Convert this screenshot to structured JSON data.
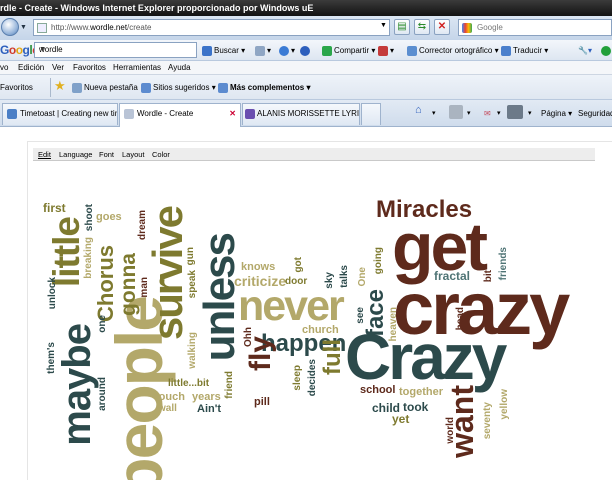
{
  "window": {
    "title": "rdle - Create - Windows Internet Explorer proporcionado por Windows uE"
  },
  "address": {
    "prefix": "http://www.",
    "domain": "wordle.net",
    "path": "/create",
    "search_placeholder": "Google"
  },
  "google_toolbar": {
    "logo": "Google",
    "query": "wordle",
    "buscar": "Buscar",
    "compartir": "Compartir",
    "corrector": "Corrector ortográfico",
    "traducir": "Traducir"
  },
  "menu": [
    "vo",
    "Edición",
    "Ver",
    "Favoritos",
    "Herramientas",
    "Ayuda"
  ],
  "favorites": {
    "label": "Favoritos",
    "items": [
      "Nueva pestaña",
      "Sitios sugeridos",
      "Más complementos"
    ]
  },
  "tabs": [
    {
      "label": "Timetoast | Creating new tim..."
    },
    {
      "label": "Wordle - Create"
    },
    {
      "label": "ALANIS MORISSETTE LYRICS..."
    }
  ],
  "command_bar": {
    "pagina": "Página",
    "seguridad": "Seguridad"
  },
  "wordle_menu": [
    "Edit",
    "Language",
    "Font",
    "Layout",
    "Color"
  ],
  "colors": {
    "dark_teal": "#2c4a4b",
    "brown": "#5e2a1c",
    "olive": "#7e7a2f",
    "khaki": "#b3a86a",
    "teal_light": "#4f7475"
  },
  "words": [
    {
      "text": "crazy"
    },
    {
      "text": "get"
    },
    {
      "text": "Crazy"
    },
    {
      "text": "people"
    },
    {
      "text": "never"
    },
    {
      "text": "Miracles"
    },
    {
      "text": "unless"
    },
    {
      "text": "survive"
    },
    {
      "text": "maybe"
    },
    {
      "text": "little"
    },
    {
      "text": "want"
    },
    {
      "text": "happen"
    },
    {
      "text": "fly"
    },
    {
      "text": "face"
    },
    {
      "text": "full"
    },
    {
      "text": "gonna"
    },
    {
      "text": "Chorus"
    },
    {
      "text": "knows"
    },
    {
      "text": "criticize"
    },
    {
      "text": "first"
    },
    {
      "text": "shoot"
    },
    {
      "text": "goes"
    },
    {
      "text": "breaking"
    },
    {
      "text": "dream"
    },
    {
      "text": "man"
    },
    {
      "text": "one"
    },
    {
      "text": "unlock"
    },
    {
      "text": "them's"
    },
    {
      "text": "around"
    },
    {
      "text": "touch"
    },
    {
      "text": "years"
    },
    {
      "text": "little...bit"
    },
    {
      "text": "wall"
    },
    {
      "text": "Ain't"
    },
    {
      "text": "walking"
    },
    {
      "text": "speak"
    },
    {
      "text": "gun"
    },
    {
      "text": "friend"
    },
    {
      "text": "Ohh"
    },
    {
      "text": "pill"
    },
    {
      "text": "church"
    },
    {
      "text": "door"
    },
    {
      "text": "got"
    },
    {
      "text": "sleep"
    },
    {
      "text": "decides"
    },
    {
      "text": "sky"
    },
    {
      "text": "talks"
    },
    {
      "text": "One"
    },
    {
      "text": "going"
    },
    {
      "text": "see"
    },
    {
      "text": "heaven"
    },
    {
      "text": "fractal"
    },
    {
      "text": "bit"
    },
    {
      "text": "friends"
    },
    {
      "text": "head"
    },
    {
      "text": "school"
    },
    {
      "text": "together"
    },
    {
      "text": "child"
    },
    {
      "text": "took"
    },
    {
      "text": "yet"
    },
    {
      "text": "world"
    },
    {
      "text": "seventy"
    },
    {
      "text": "yellow"
    }
  ]
}
